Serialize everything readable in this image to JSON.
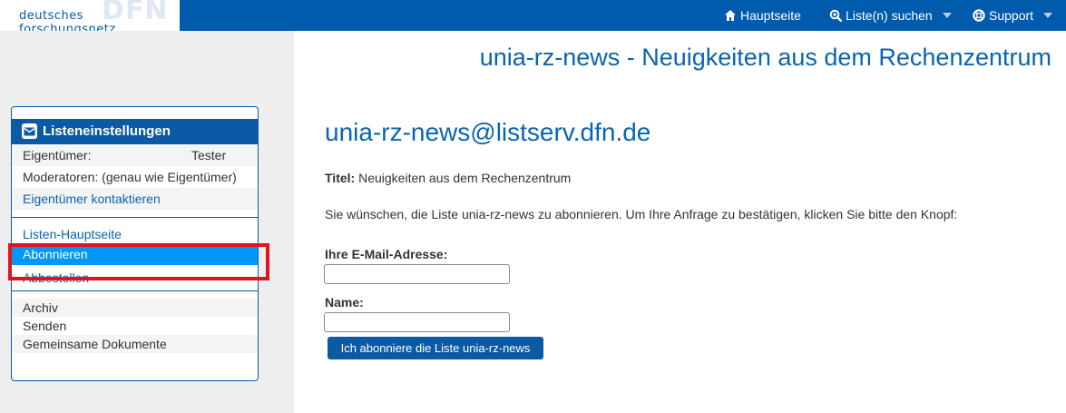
{
  "brand": {
    "logo_text": "deutsches forschungsnetz",
    "logo_mark": "DFN"
  },
  "topnav": {
    "home": "Hauptseite",
    "search": "Liste(n) suchen",
    "support": "Support"
  },
  "page_title": "unia-rz-news - Neuigkeiten aus dem Rechenzentrum",
  "sidebar": {
    "header": "Listeneinstellungen",
    "owner_label": "Eigentümer:",
    "owner_value": "Tester",
    "moderators": "Moderatoren: (genau wie Eigentümer)",
    "contact_owner": "Eigentümer kontaktieren",
    "list_home": "Listen-Hauptseite",
    "subscribe": "Abonnieren",
    "unsubscribe": "Abbestellen",
    "archive": "Archiv",
    "send": "Senden",
    "shared_docs": "Gemeinsame Dokumente"
  },
  "main": {
    "list_address": "unia-rz-news@listserv.dfn.de",
    "title_label": "Titel:",
    "title_value": " Neuigkeiten aus dem Rechenzentrum",
    "intro": "Sie wünschen, die Liste unia-rz-news zu abonnieren. Um Ihre Anfrage zu bestätigen, klicken Sie bitte den Knopf:",
    "email_label": "Ihre E-Mail-Adresse:",
    "email_value": "",
    "name_label": "Name:",
    "name_value": "",
    "submit_label": "Ich abonniere die Liste unia-rz-news"
  },
  "colors": {
    "primary": "#005bad",
    "active": "#0097f6",
    "highlight": "#e0141e"
  }
}
